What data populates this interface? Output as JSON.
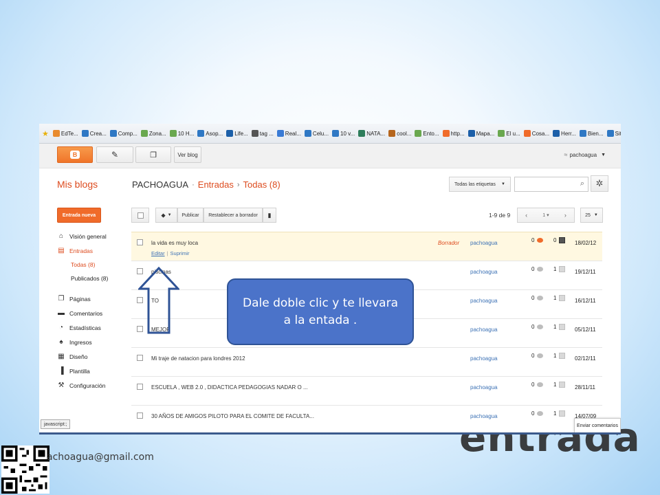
{
  "slide": {
    "background_title": "entrada",
    "email": "achoagua@gmail.com",
    "callout_text": "Dale doble clic y te llevara a la entada ."
  },
  "browser": {
    "bookmarks": [
      {
        "label": "EdTe...",
        "color": "#e98b2f"
      },
      {
        "label": "Crea...",
        "color": "#2f78c4"
      },
      {
        "label": "Comp...",
        "color": "#2f78c4"
      },
      {
        "label": "Zona...",
        "color": "#6aa84f"
      },
      {
        "label": "10 H...",
        "color": "#6aa84f"
      },
      {
        "label": "Asop...",
        "color": "#2f78c4"
      },
      {
        "label": "Life...",
        "color": "#1c5fa8"
      },
      {
        "label": "tag ...",
        "color": "#555555"
      },
      {
        "label": "Real...",
        "color": "#3a7bd5"
      },
      {
        "label": "Celu...",
        "color": "#2f78c4"
      },
      {
        "label": "10 v...",
        "color": "#2f78c4"
      },
      {
        "label": "NATA...",
        "color": "#2e7d5b"
      },
      {
        "label": "cool...",
        "color": "#b5651d"
      },
      {
        "label": "Ento...",
        "color": "#6aa84f"
      },
      {
        "label": "http...",
        "color": "#f06b2a"
      },
      {
        "label": "Mapa...",
        "color": "#1c5fa8"
      },
      {
        "label": "El u...",
        "color": "#6aa84f"
      },
      {
        "label": "Cosa...",
        "color": "#f06b2a"
      },
      {
        "label": "Herr...",
        "color": "#1c5fa8"
      },
      {
        "label": "Bien...",
        "color": "#2f78c4"
      },
      {
        "label": "Siti...",
        "color": "#2f78c4"
      }
    ],
    "status_text": "javascript:;"
  },
  "blogger": {
    "view_blog": "Ver blog",
    "username": "pachoagua",
    "my_blogs": "Mis blogs",
    "breadcrumb": {
      "blog": "PACHOAGUA",
      "section": "Entradas",
      "filter": "Todas (8)"
    },
    "labels_dropdown": "Todas las etiquetas",
    "new_post": "Entrada nueva",
    "nav": [
      {
        "label": "Visión general",
        "icon": "home-icon",
        "glyph": "⌂",
        "active": false
      },
      {
        "label": "Entradas",
        "icon": "posts-icon",
        "glyph": "▤",
        "active": true
      }
    ],
    "nav_sub": [
      {
        "label": "Todas (8)",
        "active": true
      },
      {
        "label": "Publicados (8)",
        "active": false
      }
    ],
    "nav2": [
      {
        "label": "Páginas",
        "icon": "pages-icon",
        "glyph": "❐"
      },
      {
        "label": "Comentarios",
        "icon": "comments-icon",
        "glyph": "▬"
      },
      {
        "label": "Estadísticas",
        "icon": "stats-icon",
        "glyph": "◔"
      },
      {
        "label": "Ingresos",
        "icon": "trophy-icon",
        "glyph": "♠"
      },
      {
        "label": "Diseño",
        "icon": "layout-icon",
        "glyph": "▦"
      },
      {
        "label": "Plantilla",
        "icon": "template-icon",
        "glyph": "▐"
      },
      {
        "label": "Configuración",
        "icon": "wrench-icon",
        "glyph": "⚒"
      }
    ],
    "toolbar": {
      "publish": "Publicar",
      "revert": "Restablecer a borrador"
    },
    "pager": {
      "range": "1-9 de 9",
      "page": "1",
      "per_page": "25"
    },
    "posts": [
      {
        "title": "la vida es muy loca",
        "edit": "Editar",
        "delete": "Suprimir",
        "status": "Borrador",
        "author": "pachoagua",
        "comments": "0",
        "views": "0",
        "date": "18/02/12",
        "highlight": true
      },
      {
        "title": "piscinas",
        "edit": "",
        "delete": "",
        "status": "",
        "author": "pachoagua",
        "comments": "0",
        "views": "1",
        "date": "19/12/11",
        "highlight": false
      },
      {
        "title": "TO",
        "edit": "",
        "delete": "",
        "status": "",
        "author": "pachoagua",
        "comments": "0",
        "views": "1",
        "date": "16/12/11",
        "highlight": false
      },
      {
        "title": "MEJOR",
        "edit": "",
        "delete": "",
        "status": "",
        "author": "pachoagua",
        "comments": "0",
        "views": "1",
        "date": "05/12/11",
        "highlight": false
      },
      {
        "title": "Mi traje de natacion para londres 2012",
        "edit": "",
        "delete": "",
        "status": "",
        "author": "pachoagua",
        "comments": "0",
        "views": "1",
        "date": "02/12/11",
        "highlight": false
      },
      {
        "title": "ESCUELA , WEB 2.0 , DIDACTICA PEDAGOGIAS NADAR O ...",
        "edit": "",
        "delete": "",
        "status": "",
        "author": "pachoagua",
        "comments": "0",
        "views": "1",
        "date": "28/11/11",
        "highlight": false
      },
      {
        "title": "30 AÑOS DE AMIGOS PILOTO PARA EL COMITE DE FACULTA...",
        "edit": "",
        "delete": "",
        "status": "",
        "author": "pachoagua",
        "comments": "0",
        "views": "1",
        "date": "14/07/09",
        "highlight": false
      }
    ],
    "send_comments": "Enviar comentarios"
  },
  "colors": {
    "accent": "#f06b2a",
    "link": "#3d72b5",
    "callout": "#4b73c9"
  }
}
